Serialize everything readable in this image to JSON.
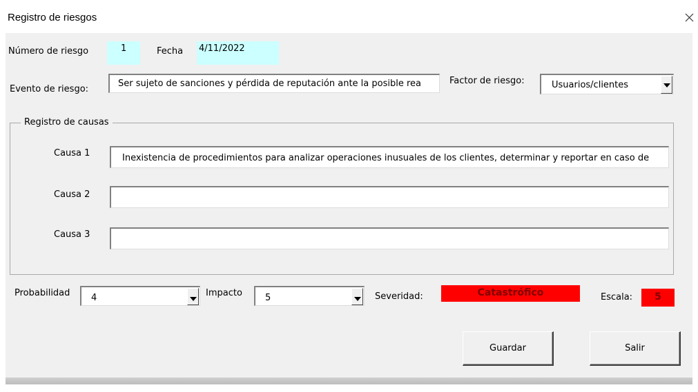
{
  "window": {
    "title": "Registro de riesgos",
    "close_icon": "close-icon"
  },
  "header": {
    "numero_label": "Número de riesgo",
    "numero_value": "1",
    "fecha_label": "Fecha",
    "fecha_value": "4/11/2022"
  },
  "evento": {
    "label": "Evento de riesgo:",
    "value": "Ser sujeto de sanciones y pérdida de reputación   ante la posible rea"
  },
  "factor": {
    "label": "Factor de riesgo:",
    "value": "Usuarios/clientes"
  },
  "causas": {
    "legend": "Registro de causas",
    "items": [
      {
        "label": "Causa 1",
        "value": "Inexistencia de procedimientos para analizar operaciones inusuales de los clientes, determinar y reportar en caso de"
      },
      {
        "label": "Causa 2",
        "value": ""
      },
      {
        "label": "Causa 3",
        "value": ""
      }
    ]
  },
  "evaluacion": {
    "probabilidad_label": "Probabilidad",
    "probabilidad_value": "4",
    "impacto_label": "Impacto",
    "impacto_value": "5",
    "severidad_label": "Severidad:",
    "severidad_value": "Catastrófico",
    "escala_label": "Escala:",
    "escala_value": "5",
    "severity_color": "#ff0000"
  },
  "buttons": {
    "guardar": "Guardar",
    "salir": "Salir"
  }
}
